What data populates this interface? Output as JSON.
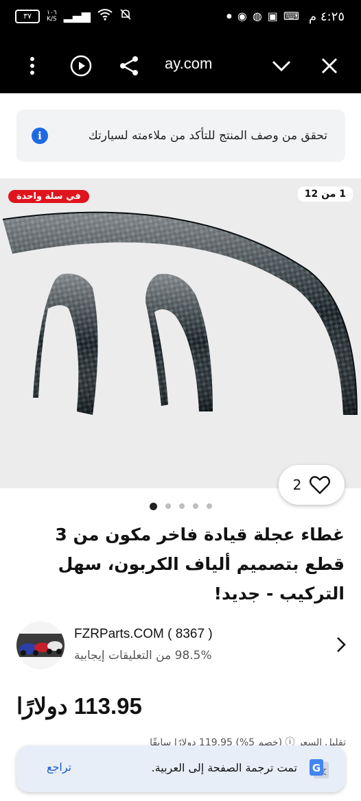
{
  "status_bar": {
    "time": "٤:٢٥ م",
    "battery": "٣٧",
    "net_speed_value": "١٠٦",
    "net_speed_unit": "K/S"
  },
  "toolbar": {
    "url": "ay.com",
    "icons": [
      "more-vert-icon",
      "play-icon",
      "share-icon",
      "chevron-down-icon",
      "close-icon"
    ]
  },
  "notice": {
    "text": "تحقق من وصف المنتج للتأكد من ملاءمته لسيارتك",
    "icon": "info-icon"
  },
  "gallery": {
    "counter": "1 من 12",
    "badge": "في سلة واحدة",
    "watch_count": "2",
    "dots_total": 5,
    "dots_active": 0
  },
  "product": {
    "title": "غطاء عجلة قيادة فاخر مكون من 3 قطع بتصميم ألياف الكربون، سهل التركيب - جديد!"
  },
  "seller": {
    "name": "FZRParts.COM ( 8367 )",
    "feedback": "98.5% من التعليقات إيجابية"
  },
  "price": {
    "value": "113.95 دولارًا",
    "sub": "تقليل السعر ⓘ (خصم 5%) 119.95 دولارًا سابقًا"
  },
  "toast": {
    "message": "تمت ترجمة الصفحة إلى العربية.",
    "undo": "تراجع"
  },
  "colors": {
    "badge_red": "#e0141e",
    "link_blue": "#1a5dc8",
    "info_blue": "#1f6ae0",
    "toolbar_bg": "#000000"
  }
}
